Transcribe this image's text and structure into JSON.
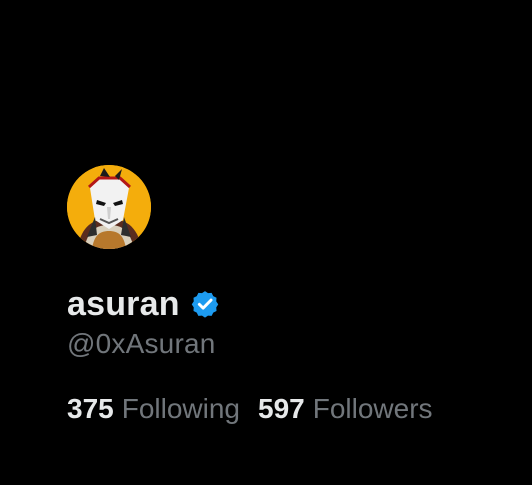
{
  "profile": {
    "display_name": "asuran",
    "handle": "@0xAsuran",
    "verified_icon": "verified-badge-icon",
    "avatar_icon": "avatar-image"
  },
  "stats": {
    "following_count": "375",
    "following_label": "Following",
    "followers_count": "597",
    "followers_label": "Followers"
  },
  "colors": {
    "background": "#000000",
    "primary_text": "#e7e9ea",
    "secondary_text": "#71767b",
    "verified_blue": "#1d9bf0",
    "avatar_yellow": "#f4ad0c"
  }
}
